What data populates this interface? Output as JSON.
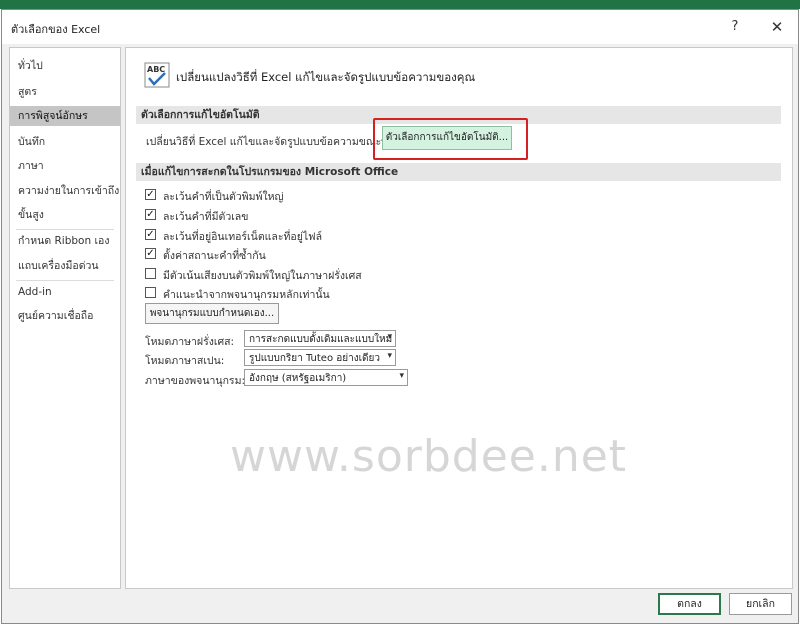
{
  "window": {
    "title": "ตัวเลือกของ Excel",
    "help_glyph": "?",
    "close_glyph": "✕"
  },
  "nav": {
    "items": [
      {
        "label": "ทั่วไป"
      },
      {
        "label": "สูตร"
      },
      {
        "label": "การพิสูจน์อักษร"
      },
      {
        "label": "บันทึก"
      },
      {
        "label": "ภาษา"
      },
      {
        "label": "ความง่ายในการเข้าถึง"
      },
      {
        "label": "ขั้นสูง"
      },
      {
        "label": "กำหนด Ribbon เอง"
      },
      {
        "label": "แถบเครื่องมือด่วน"
      },
      {
        "label": "Add-in"
      },
      {
        "label": "ศูนย์ความเชื่อถือ"
      }
    ],
    "selected": "การพิสูจน์อักษร"
  },
  "content": {
    "intro": "เปลี่ยนแปลงวิธีที่ Excel แก้ไขและจัดรูปแบบข้อความของคุณ",
    "autocorrect": {
      "header": "ตัวเลือกการแก้ไขอัตโนมัติ",
      "description": "เปลี่ยนวิธีที่ Excel แก้ไขและจัดรูปแบบข้อความขณะพิมพ์:",
      "button_label": "ตัวเลือกการแก้ไขอัตโนมัติ..."
    },
    "spelling": {
      "header": "เมื่อแก้ไขการสะกดในโปรแกรมของ Microsoft Office",
      "checkboxes": [
        {
          "label": "ละเว้นคำที่เป็นตัวพิมพ์ใหญ่",
          "checked": true
        },
        {
          "label": "ละเว้นคำที่มีตัวเลข",
          "checked": true
        },
        {
          "label": "ละเว้นที่อยู่อินเทอร์เน็ตและที่อยู่ไฟล์",
          "checked": true
        },
        {
          "label": "ตั้งค่าสถานะคำที่ซ้ำกัน",
          "checked": true
        },
        {
          "label": "มีตัวเน้นเสียงบนตัวพิมพ์ใหญ่ในภาษาฝรั่งเศส",
          "checked": false
        },
        {
          "label": "คำแนะนำจากพจนานุกรมหลักเท่านั้น",
          "checked": false
        }
      ],
      "check_glyph": "✓",
      "custom_dict_button": "พจนานุกรมแบบกำหนดเอง...",
      "french_label": "โหมดภาษาฝรั่งเศส:",
      "french_value": "การสะกดแบบดั้งเดิมและแบบใหม่",
      "spanish_label": "โหมดภาษาสเปน:",
      "spanish_value": "รูปแบบกริยา Tuteo อย่างเดียว",
      "dict_lang_label": "ภาษาของพจนานุกรม:",
      "dict_lang_value": "อังกฤษ (สหรัฐอเมริกา)",
      "combo_arrow": "▾"
    }
  },
  "watermark": "www.sorbdee.net",
  "footer": {
    "ok_label": "ตกลง",
    "cancel_label": "ยกเลิก"
  },
  "colors": {
    "excel_green": "#217346",
    "highlight_red": "#d42020",
    "button_green": "#d4f2e0",
    "selected_nav": "#c5c5c5"
  }
}
